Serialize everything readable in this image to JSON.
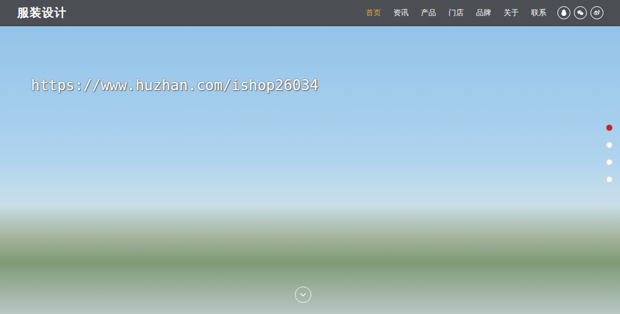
{
  "header": {
    "logo": "服装设计",
    "nav": [
      {
        "label": "首页",
        "selected": true
      },
      {
        "label": "资讯",
        "selected": false
      },
      {
        "label": "产品",
        "selected": false
      },
      {
        "label": "门店",
        "selected": false
      },
      {
        "label": "品牌",
        "selected": false
      },
      {
        "label": "关于",
        "selected": false
      },
      {
        "label": "联系",
        "selected": false
      }
    ]
  },
  "watermark": "https://www.huzhan.com/ishop26034",
  "slides": [
    {
      "selected": true
    },
    {
      "selected": false
    },
    {
      "selected": false
    },
    {
      "selected": false
    }
  ]
}
